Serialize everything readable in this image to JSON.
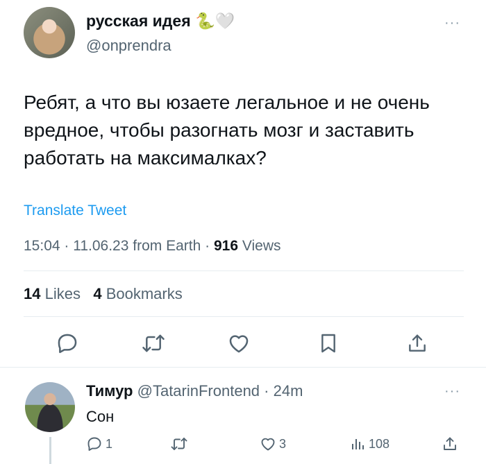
{
  "tweet": {
    "display_name": "русская идея",
    "name_emojis": "🐍🤍",
    "handle": "@onprendra",
    "text": "Ребят, а что вы юзаете легальное и не очень вредное, чтобы разогнать мозг и заставить работать на максималках?",
    "translate_label": "Translate Tweet",
    "time": "15:04",
    "date": "11.06.23",
    "source": "from Earth",
    "views_count": "916",
    "views_label": "Views",
    "likes_count": "14",
    "likes_label": "Likes",
    "bookmarks_count": "4",
    "bookmarks_label": "Bookmarks",
    "more_icon": "···"
  },
  "reply": {
    "display_name": "Тимур",
    "handle": "@TatarinFrontend",
    "time_ago": "24m",
    "text": "Сон",
    "replies": "1",
    "likes": "3",
    "views": "108",
    "more_icon": "···"
  },
  "colors": {
    "accent": "#1d9bf0",
    "text": "#0f1419",
    "secondary": "#536471",
    "divider": "#e6ecf0"
  },
  "icons": [
    "reply-icon",
    "retweet-icon",
    "like-icon",
    "bookmark-icon",
    "share-icon",
    "views-icon",
    "more-icon"
  ]
}
